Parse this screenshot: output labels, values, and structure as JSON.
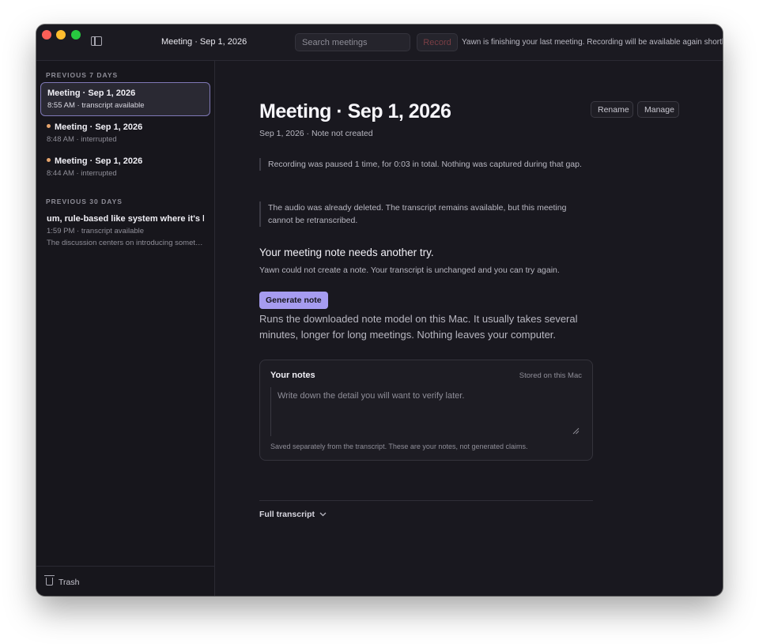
{
  "window": {
    "title": "Meeting · Sep 1, 2026"
  },
  "toolbar": {
    "search_placeholder": "Search meetings",
    "record_label": "Record",
    "status": "Yawn is finishing your last meeting. Recording will be available again shortly."
  },
  "sidebar": {
    "sections": [
      {
        "label": "PREVIOUS 7 DAYS",
        "items": [
          {
            "title": "Meeting · Sep 1, 2026",
            "subtitle": "8:55 AM · transcript available",
            "selected": true,
            "interrupted": false
          },
          {
            "title": "Meeting · Sep 1, 2026",
            "subtitle": "8:48 AM · interrupted",
            "selected": false,
            "interrupted": true
          },
          {
            "title": "Meeting · Sep 1, 2026",
            "subtitle": "8:44 AM · interrupted",
            "selected": false,
            "interrupted": true
          }
        ]
      },
      {
        "label": "PREVIOUS 30 DAYS",
        "items": [
          {
            "title": "um, rule-based like system where it's lik",
            "subtitle": "1:59 PM · transcript available",
            "preview": "The discussion centers on introducing somet…",
            "selected": false,
            "interrupted": false
          }
        ]
      }
    ],
    "trash_label": "Trash"
  },
  "main": {
    "title": "Meeting · Sep 1, 2026",
    "subtitle": "Sep 1, 2026 · Note not created",
    "rename_label": "Rename",
    "manage_label": "Manage",
    "notices": [
      "Recording was paused 1 time, for 0:03 in total. Nothing was captured during that gap.",
      "The audio was already deleted. The transcript remains available, but this meeting cannot be retranscribed."
    ],
    "retry": {
      "heading": "Your meeting note needs another try.",
      "body": "Yawn could not create a note. Your transcript is unchanged and you can try again.",
      "button_label": "Generate note",
      "help": "Runs the downloaded note model on this Mac. It usually takes several minutes, longer for long meetings. Nothing leaves your computer."
    },
    "notes": {
      "title": "Your notes",
      "stored": "Stored on this Mac",
      "placeholder": "Write down the detail you will want to verify later.",
      "footer": "Saved separately from the transcript. These are your notes, not generated claims."
    },
    "transcript_label": "Full transcript"
  },
  "colors": {
    "accent": "#a69cf0",
    "selected_border": "#7f78b6",
    "interrupted_dot": "#e5a46d",
    "record_text": "#7a3e44"
  },
  "icons": [
    "sidebar-toggle-icon",
    "trash-icon",
    "resize-handle-icon",
    "chevron-down-icon"
  ]
}
